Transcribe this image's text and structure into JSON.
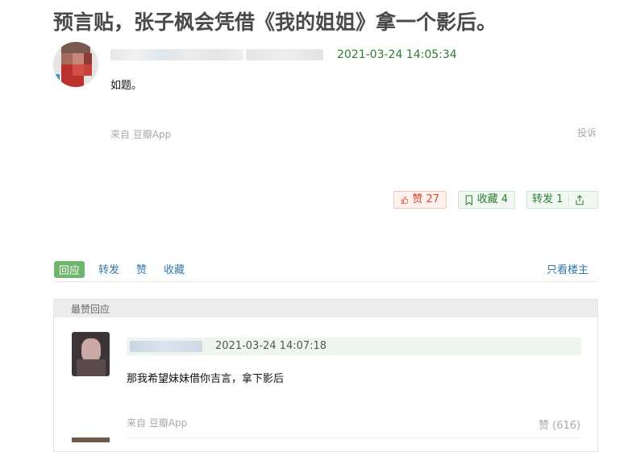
{
  "post": {
    "title": "预言贴，张子枫会凭借《我的姐姐》拿一个影后。",
    "time": "2021-03-24 14:05:34",
    "body": "如题。",
    "source": "来自 豆瓣App",
    "report": "投诉"
  },
  "actions": {
    "like_label": "赞 27",
    "collect_label": "收藏 4",
    "share_label": "转发  1"
  },
  "tabs": {
    "reply": "回应",
    "forward": "转发",
    "like": "赞",
    "collect": "收藏",
    "only_author": "只看楼主"
  },
  "best_replies": {
    "header": "最赞回应",
    "items": [
      {
        "time": "2021-03-24 14:07:18",
        "text": "那我希望妹妹借你吉言，拿下影后",
        "source": "来自 豆瓣App",
        "likes": "赞 (616)"
      }
    ]
  },
  "colors": {
    "accent_green": "#2e7d32",
    "link_blue": "#3377aa",
    "like_red": "#d64a2e",
    "tab_active_bg": "#6fb56b"
  },
  "icons": [
    "thumb-up-icon",
    "bookmark-icon",
    "share-out-icon"
  ]
}
